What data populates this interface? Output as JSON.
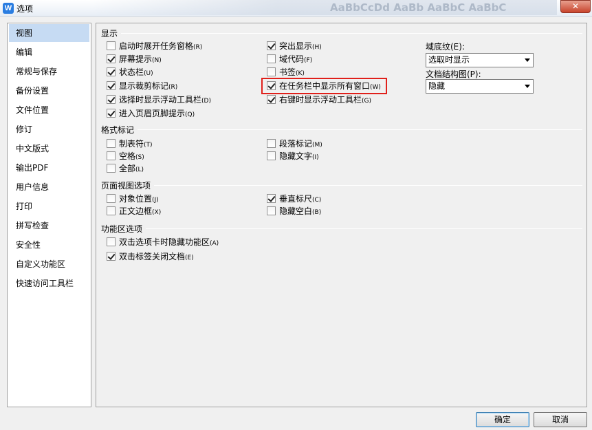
{
  "window": {
    "title": "选项",
    "ribbon_ghost_text": "AaBbCcDd AaBb AaBbC AaBbC",
    "close_glyph": "✕"
  },
  "nav": {
    "items": [
      {
        "label": "视图",
        "selected": true
      },
      {
        "label": "编辑"
      },
      {
        "label": "常规与保存"
      },
      {
        "label": "备份设置"
      },
      {
        "label": "文件位置"
      },
      {
        "label": "修订"
      },
      {
        "label": "中文版式"
      },
      {
        "label": "输出PDF"
      },
      {
        "label": "用户信息"
      },
      {
        "label": "打印"
      },
      {
        "label": "拼写检查"
      },
      {
        "label": "安全性"
      },
      {
        "label": "自定义功能区"
      },
      {
        "label": "快速访问工具栏"
      }
    ]
  },
  "display": {
    "heading": "显示",
    "col1": [
      {
        "label": "启动时展开任务窗格",
        "key": "(R)",
        "checked": false
      },
      {
        "label": "屏幕提示",
        "key": "(N)",
        "checked": true
      },
      {
        "label": "状态栏",
        "key": "(U)",
        "checked": true
      },
      {
        "label": "显示裁剪标记",
        "key": "(R)",
        "checked": true
      },
      {
        "label": "选择时显示浮动工具栏",
        "key": "(D)",
        "checked": true
      },
      {
        "label": "进入页眉页脚提示",
        "key": "(Q)",
        "checked": true
      }
    ],
    "col2": [
      {
        "label": "突出显示",
        "key": "(H)",
        "checked": true
      },
      {
        "label": "域代码",
        "key": "(F)",
        "checked": false
      },
      {
        "label": "书签",
        "key": "(K)",
        "checked": false
      },
      {
        "label": "在任务栏中显示所有窗口",
        "key": "(W)",
        "checked": true
      },
      {
        "label": "右键时显示浮动工具栏",
        "key": "(G)",
        "checked": true
      }
    ],
    "field_shading": {
      "label": "域底纹(E):",
      "value": "选取时显示"
    },
    "doc_map": {
      "label": "文档结构图(P):",
      "value": "隐藏"
    }
  },
  "format_marks": {
    "heading": "格式标记",
    "col1": [
      {
        "label": "制表符",
        "key": "(T)",
        "checked": false
      },
      {
        "label": "空格",
        "key": "(S)",
        "checked": false
      },
      {
        "label": "全部",
        "key": "(L)",
        "checked": false
      }
    ],
    "col2": [
      {
        "label": "段落标记",
        "key": "(M)",
        "checked": false
      },
      {
        "label": "隐藏文字",
        "key": "(I)",
        "checked": false
      }
    ]
  },
  "page_view": {
    "heading": "页面视图选项",
    "col1": [
      {
        "label": "对象位置",
        "key": "(J)",
        "checked": false
      },
      {
        "label": "正文边框",
        "key": "(X)",
        "checked": false
      }
    ],
    "col2": [
      {
        "label": "垂直标尺",
        "key": "(C)",
        "checked": true
      },
      {
        "label": "隐藏空白",
        "key": "(B)",
        "checked": false
      }
    ]
  },
  "ribbon": {
    "heading": "功能区选项",
    "items": [
      {
        "label": "双击选项卡时隐藏功能区",
        "key": "(A)",
        "checked": false
      },
      {
        "label": "双击标签关闭文档",
        "key": "(E)",
        "checked": true
      }
    ]
  },
  "buttons": {
    "ok": "确定",
    "cancel": "取消"
  },
  "colors": {
    "highlight": "#e0201b",
    "nav_selected": "#c6dbf3"
  }
}
